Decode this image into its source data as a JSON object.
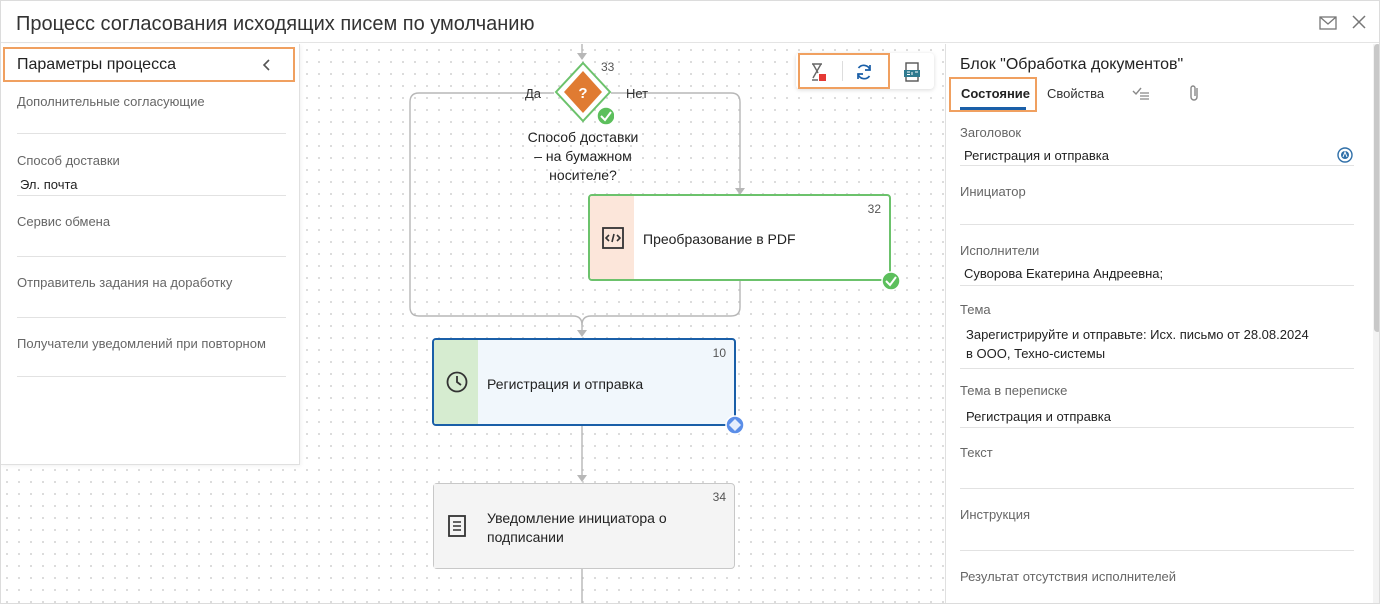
{
  "window": {
    "title": "Процесс согласования исходящих писем по умолчанию"
  },
  "left_panel": {
    "title": "Параметры процесса",
    "fields": [
      {
        "label": "Дополнительные согласующие",
        "value": ""
      },
      {
        "label": "Способ доставки",
        "value": "Эл. почта"
      },
      {
        "label": "Сервис обмена",
        "value": ""
      },
      {
        "label": "Отправитель задания на доработку",
        "value": ""
      },
      {
        "label": "Получатели уведомлений при повторном",
        "value": ""
      }
    ]
  },
  "flow": {
    "condition": {
      "number": "33",
      "label_lines": [
        "Способ доставки",
        "– на бумажном",
        "носителе?"
      ],
      "yes": "Да",
      "no": "Нет",
      "icon": "question-icon"
    },
    "nodes": [
      {
        "id": "pdf",
        "number": "32",
        "label": "Преобразование в PDF",
        "icon": "code-icon",
        "strip_color": "#fce6da",
        "border_color": "#6cc26c"
      },
      {
        "id": "register",
        "number": "10",
        "label": "Регистрация и отправка",
        "icon": "clock-icon",
        "strip_color": "#d6ecd0",
        "border_color": "#1a5fa8",
        "selected": true
      },
      {
        "id": "notify",
        "number": "34",
        "label_lines": [
          "Уведомление инициатора о",
          "подписании"
        ],
        "icon": "document-icon",
        "strip_color": "#f4f4f4",
        "border_color": "#c8c8c8"
      }
    ]
  },
  "toolbar": {
    "buttons": [
      "hourglass-stop-icon",
      "refresh-icon",
      "pdf-export-icon"
    ]
  },
  "right_panel": {
    "title": "Блок \"Обработка документов\"",
    "tabs": [
      {
        "label": "Состояние",
        "active": true
      },
      {
        "label": "Свойства",
        "active": false
      }
    ],
    "tab_icons": [
      "checklist-icon",
      "paperclip-icon"
    ],
    "fields": [
      {
        "label": "Заголовок",
        "value": "Регистрация и отправка"
      },
      {
        "label": "Инициатор",
        "value": ""
      },
      {
        "label": "Исполнители",
        "value": "Суворова Екатерина Андреевна;"
      },
      {
        "label": "Тема",
        "value_lines": [
          "Зарегистрируйте и отправьте: Исх. письмо от 28.08.2024",
          "в ООО, Техно-системы"
        ]
      },
      {
        "label": "Тема в переписке",
        "value": "Регистрация и отправка"
      },
      {
        "label": "Текст",
        "value": ""
      },
      {
        "label": "Инструкция",
        "value": ""
      },
      {
        "label": "Результат отсутствия исполнителей",
        "value": ""
      }
    ]
  },
  "colors": {
    "accent": "#1a5fa8",
    "highlight": "#f0a060",
    "success": "#5cbf5c",
    "condition": "#e07b32",
    "stop": "#e53935"
  }
}
